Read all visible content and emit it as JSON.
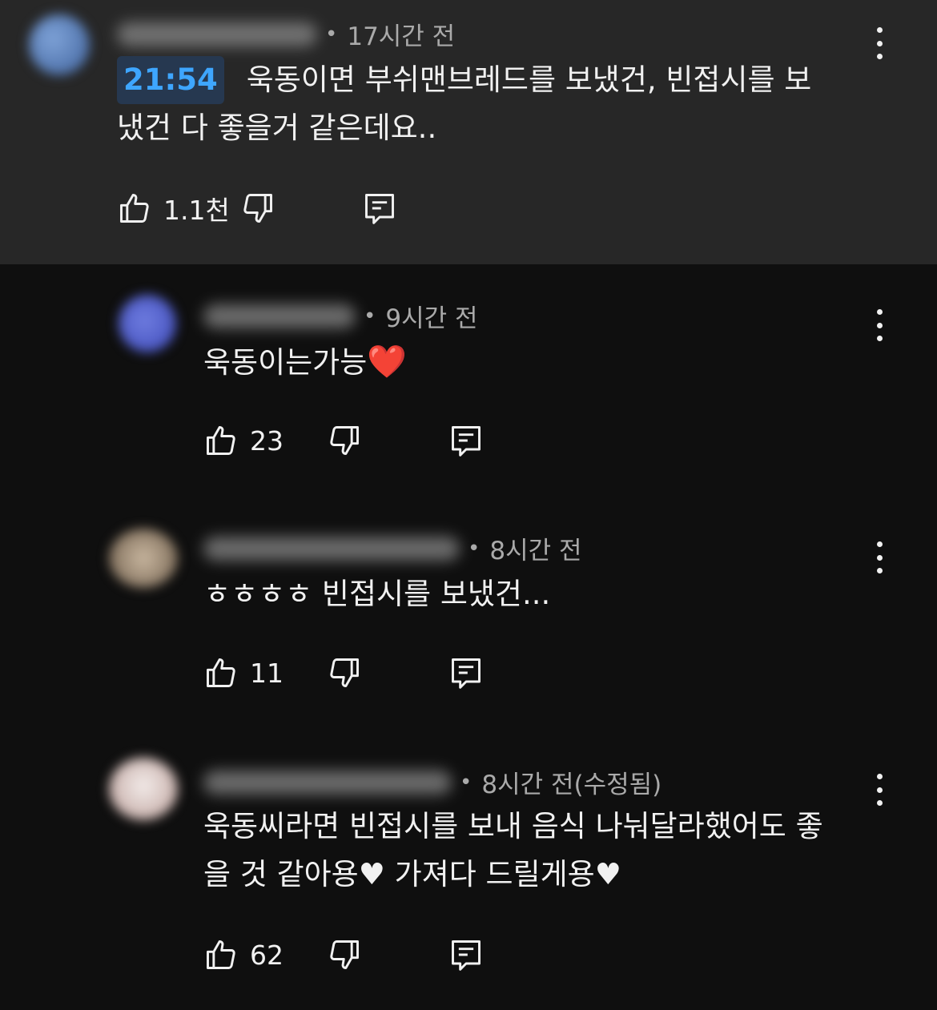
{
  "comments": [
    {
      "time": "17시간 전",
      "timestamp": "21:54",
      "text": "욱동이면  부쉬맨브레드를 보냈건, 빈접시를 보",
      "text2": "냈건 다 좋을거 같은데요..",
      "likes": "1.1천"
    },
    {
      "time": "9시간 전",
      "text": "욱동이는가능",
      "emoji": "❤️",
      "likes": "23"
    },
    {
      "time": "8시간 전",
      "text": "ㅎㅎㅎㅎ 빈접시를 보냈건...",
      "likes": "11"
    },
    {
      "time": "8시간 전(수정됨)",
      "text": "욱동씨라면 빈접시를 보내 음식 나눠달라했어도 좋",
      "text2": "을 것 같아용♥ 가져다 드릴게용♥",
      "likes": "62"
    }
  ],
  "icons": {
    "like": "thumbs-up-icon",
    "dislike": "thumbs-down-icon",
    "reply": "comment-reply-icon",
    "more": "more-vertical-icon"
  },
  "colors": {
    "background": "#0f0f0f",
    "highlight_background": "#272727",
    "timestamp_link": "#3ea6ff",
    "heart": "#e0223a"
  }
}
